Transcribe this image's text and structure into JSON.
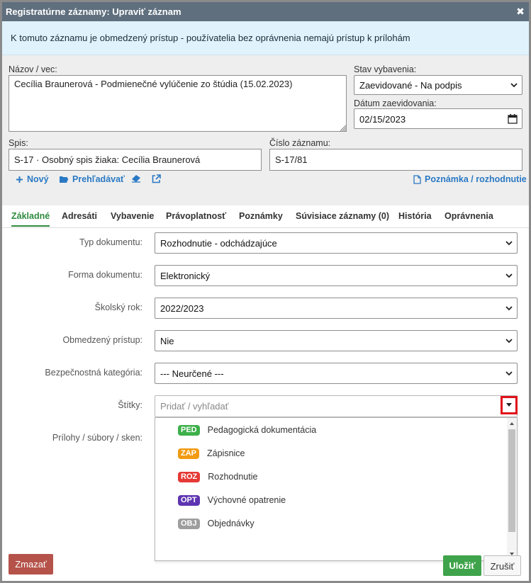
{
  "dialog": {
    "title": "Registratúrne záznamy: Upraviť záznam",
    "close_glyph": "✖",
    "info": "K tomuto záznamu je obmedzený prístup - používatelia bez oprávnenia nemajú prístup k prílohám"
  },
  "form": {
    "nazov_label": "Názov / vec:",
    "nazov_value": "Cecília Braunerová - Podmienečné vylúčenie zo štúdia (15.02.2023)",
    "stav_label": "Stav vybavenia:",
    "stav_value": "Zaevidované - Na podpis",
    "datum_label": "Dátum zaevidovania:",
    "datum_value": "02/15/2023",
    "spis_label": "Spis:",
    "spis_value": "S-17 · Osobný spis žiaka: Cecília Braunerová",
    "cislo_label": "Číslo záznamu:",
    "cislo_value": "S-17/81"
  },
  "links": {
    "novy": "Nový",
    "prehladavat": "Prehľadávať",
    "poznamka": "Poznámka / rozhodnutie"
  },
  "tabs": [
    "Základné",
    "Adresáti",
    "Vybavenie",
    "Právoplatnosť",
    "Poznámky",
    "Súvisiace záznamy (0)",
    "História",
    "Oprávnenia"
  ],
  "fields": {
    "typ_label": "Typ dokumentu:",
    "typ_value": "Rozhodnutie - odchádzajúce",
    "forma_label": "Forma dokumentu:",
    "forma_value": "Elektronický",
    "rok_label": "Školský rok:",
    "rok_value": "2022/2023",
    "pristup_label": "Obmedzený prístup:",
    "pristup_value": "Nie",
    "kategoria_label": "Bezpečnostná kategória:",
    "kategoria_value": "--- Neurčené ---",
    "stitky_label": "Štítky:",
    "stitky_placeholder": "Pridať / vyhľadať",
    "prilohy_label": "Prílohy / súbory / sken:"
  },
  "tag_options": [
    {
      "code": "PED",
      "label": "Pedagogická dokumentácia",
      "color": "#3db04a"
    },
    {
      "code": "ZAP",
      "label": "Zápisnice",
      "color": "#f29a12"
    },
    {
      "code": "ROZ",
      "label": "Rozhodnutie",
      "color": "#e53935"
    },
    {
      "code": "OPT",
      "label": "Výchovné opatrenie",
      "color": "#5e35b1"
    },
    {
      "code": "OBJ",
      "label": "Objednávky",
      "color": "#9e9e9e"
    }
  ],
  "buttons": {
    "zmazat": "Zmazať",
    "ulozit": "Uložiť",
    "zrusit": "Zrušiť"
  },
  "colors": {
    "title_bar": "#5f6f7e",
    "link": "#2a79c4",
    "active_tab": "#2e8b3e",
    "delete": "#b5534a",
    "save": "#3ea34a",
    "highlight": "#e0121a"
  }
}
